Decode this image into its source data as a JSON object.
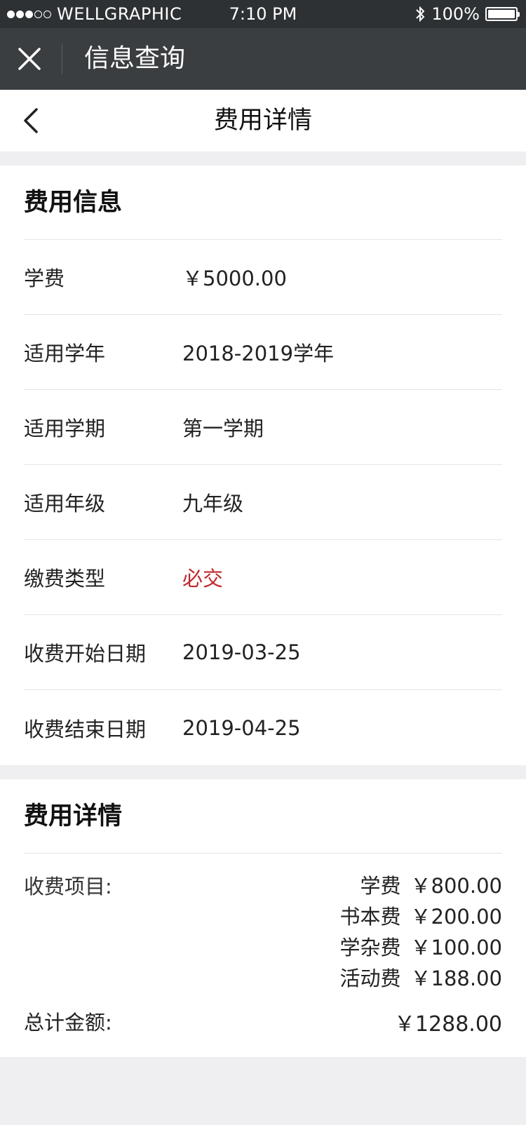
{
  "status_bar": {
    "carrier": "WELLGRAPHIC",
    "time": "7:10 PM",
    "battery": "100%",
    "signal_icon": "signal-dots-icon",
    "bluetooth_icon": "bluetooth-icon"
  },
  "app_header": {
    "title": "信息查询",
    "close_icon": "close-icon"
  },
  "nav": {
    "title": "费用详情",
    "back_icon": "chevron-left-icon"
  },
  "fee_info": {
    "section_title": "费用信息",
    "rows": [
      {
        "label": "学费",
        "value": "￥5000.00"
      },
      {
        "label": "适用学年",
        "value": "2018-2019学年"
      },
      {
        "label": "适用学期",
        "value": "第一学期"
      },
      {
        "label": "适用年级",
        "value": "九年级"
      },
      {
        "label": "缴费类型",
        "value": "必交",
        "color": "#c0282b"
      },
      {
        "label": "收费开始日期",
        "value": "2019-03-25"
      },
      {
        "label": "收费结束日期",
        "value": "2019-04-25"
      }
    ]
  },
  "fee_details": {
    "section_title": "费用详情",
    "items_label": "收费项目:",
    "items": [
      {
        "name": "学费",
        "amount": "￥800.00"
      },
      {
        "name": "书本费",
        "amount": "￥200.00"
      },
      {
        "name": "学杂费",
        "amount": "￥100.00"
      },
      {
        "name": "活动费",
        "amount": "￥188.00"
      }
    ],
    "total_label": "总计金额:",
    "total_amount": "￥1288.00"
  },
  "colors": {
    "status_bar_bg": "#2d3134",
    "header_bg": "#3a3e41",
    "page_bg": "#efeff1",
    "accent_red": "#c0282b"
  }
}
